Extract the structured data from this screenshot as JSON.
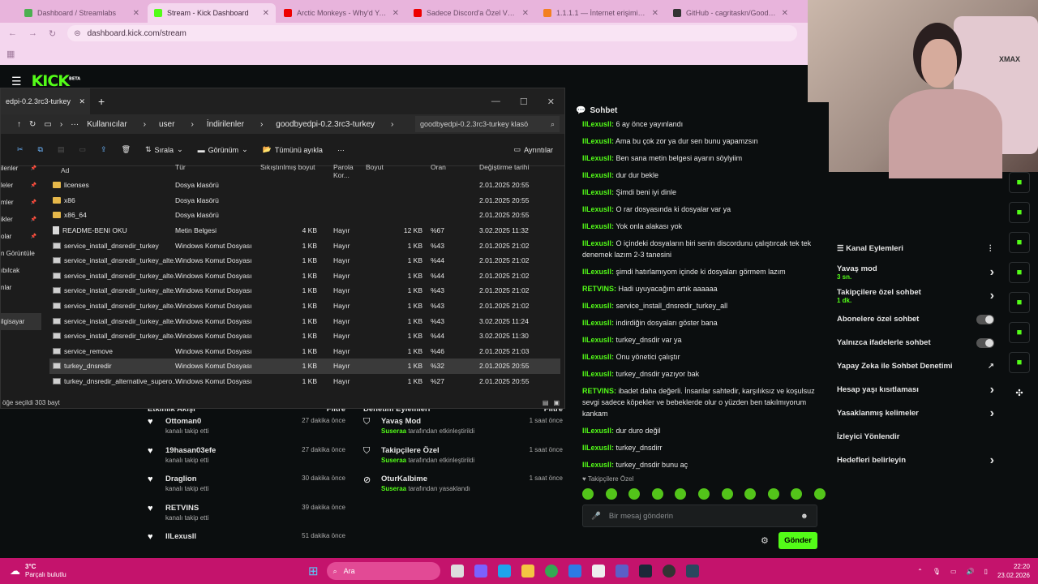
{
  "tabs": [
    {
      "title": "Dashboard / Streamlabs",
      "fav": "#4caf50"
    },
    {
      "title": "Stream - Kick Dashboard",
      "fav": "#53fc18",
      "active": true
    },
    {
      "title": "Arctic Monkeys - Why'd You O",
      "fav": "#e00"
    },
    {
      "title": "Sadece Discord'a Özel VPN N...",
      "fav": "#e00"
    },
    {
      "title": "1.1.1.1 — İnternet erişiminiz n",
      "fav": "#f38020"
    },
    {
      "title": "GitHub - cagritaskn/Goodbyel",
      "fav": "#333"
    }
  ],
  "url": "dashboard.kick.com/stream",
  "kick": {
    "logo": "KICK",
    "beta": "BETA"
  },
  "explorer": {
    "tab_title": "edpi-0.2.3rc3-turkey",
    "crumbs": [
      "Kullanıcılar",
      "user",
      "İndirilenler",
      "goodbyedpi-0.2.3rc3-turkey"
    ],
    "search": "goodbyedpi-0.2.3rc3-turkey klasö",
    "tool": {
      "sort": "Sırala",
      "view": "Görünüm",
      "select_all": "Tümünü ayıkla",
      "details": "Ayrıntılar"
    },
    "sidebar": [
      "ilenler",
      "leler",
      "mler",
      "ikler",
      "olar",
      "n Görüntüle",
      "ıbılcak",
      "nlar",
      "",
      "ilgisayar"
    ],
    "columns": [
      "Ad",
      "Tür",
      "Sıkıştırılmış boyut",
      "Parola Kor...",
      "Boyut",
      "Oran",
      "Değiştirme tarihi"
    ],
    "rows": [
      {
        "name": "licenses",
        "type": "Dosya klasörü",
        "comp": "",
        "pw": "",
        "size": "",
        "ratio": "",
        "date": "2.01.2025 20:55",
        "icon": "folder"
      },
      {
        "name": "x86",
        "type": "Dosya klasörü",
        "comp": "",
        "pw": "",
        "size": "",
        "ratio": "",
        "date": "2.01.2025 20:55",
        "icon": "folder"
      },
      {
        "name": "x86_64",
        "type": "Dosya klasörü",
        "comp": "",
        "pw": "",
        "size": "",
        "ratio": "",
        "date": "2.01.2025 20:55",
        "icon": "folder"
      },
      {
        "name": "README-BENI OKU",
        "type": "Metin Belgesi",
        "comp": "4 KB",
        "pw": "Hayır",
        "size": "12 KB",
        "ratio": "%67",
        "date": "3.02.2025 11:32",
        "icon": "file"
      },
      {
        "name": "service_install_dnsredir_turkey",
        "type": "Windows Komut Dosyası",
        "comp": "1 KB",
        "pw": "Hayır",
        "size": "1 KB",
        "ratio": "%43",
        "date": "2.01.2025 21:02",
        "icon": "cmd"
      },
      {
        "name": "service_install_dnsredir_turkey_alte...",
        "type": "Windows Komut Dosyası",
        "comp": "1 KB",
        "pw": "Hayır",
        "size": "1 KB",
        "ratio": "%44",
        "date": "2.01.2025 21:02",
        "icon": "cmd"
      },
      {
        "name": "service_install_dnsredir_turkey_alte...",
        "type": "Windows Komut Dosyası",
        "comp": "1 KB",
        "pw": "Hayır",
        "size": "1 KB",
        "ratio": "%44",
        "date": "2.01.2025 21:02",
        "icon": "cmd"
      },
      {
        "name": "service_install_dnsredir_turkey_alte...",
        "type": "Windows Komut Dosyası",
        "comp": "1 KB",
        "pw": "Hayır",
        "size": "1 KB",
        "ratio": "%43",
        "date": "2.01.2025 21:02",
        "icon": "cmd"
      },
      {
        "name": "service_install_dnsredir_turkey_alte...",
        "type": "Windows Komut Dosyası",
        "comp": "1 KB",
        "pw": "Hayır",
        "size": "1 KB",
        "ratio": "%43",
        "date": "2.01.2025 21:02",
        "icon": "cmd"
      },
      {
        "name": "service_install_dnsredir_turkey_alte...",
        "type": "Windows Komut Dosyası",
        "comp": "1 KB",
        "pw": "Hayır",
        "size": "1 KB",
        "ratio": "%43",
        "date": "3.02.2025 11:24",
        "icon": "cmd"
      },
      {
        "name": "service_install_dnsredir_turkey_alte...",
        "type": "Windows Komut Dosyası",
        "comp": "1 KB",
        "pw": "Hayır",
        "size": "1 KB",
        "ratio": "%44",
        "date": "3.02.2025 11:30",
        "icon": "cmd"
      },
      {
        "name": "service_remove",
        "type": "Windows Komut Dosyası",
        "comp": "1 KB",
        "pw": "Hayır",
        "size": "1 KB",
        "ratio": "%46",
        "date": "2.01.2025 21:03",
        "icon": "cmd"
      },
      {
        "name": "turkey_dnsredir",
        "type": "Windows Komut Dosyası",
        "comp": "1 KB",
        "pw": "Hayır",
        "size": "1 KB",
        "ratio": "%32",
        "date": "2.01.2025 20:55",
        "icon": "cmd",
        "selected": true
      },
      {
        "name": "turkey_dnsredir_alternative_supero...",
        "type": "Windows Komut Dosyası",
        "comp": "1 KB",
        "pw": "Hayır",
        "size": "1 KB",
        "ratio": "%27",
        "date": "2.01.2025 20:55",
        "icon": "cmd"
      }
    ],
    "status": "öğe seçildi  303 bayt"
  },
  "chat": {
    "title": "Sohbet",
    "messages": [
      {
        "user": "IlLexusll:",
        "text": "6 ay önce yayınlandı"
      },
      {
        "user": "IlLexusll:",
        "text": "Ama bu çok zor ya dur sen bunu yapamzsın"
      },
      {
        "user": "IlLexusll:",
        "text": "Ben sana metin belgesi ayarın söylyiim"
      },
      {
        "user": "IlLexusll:",
        "text": "dur dur bekle"
      },
      {
        "user": "IlLexusll:",
        "text": "Şimdi beni iyi dinle"
      },
      {
        "user": "IlLexusll:",
        "text": "O rar dosyasında ki dosyalar var ya"
      },
      {
        "user": "IlLexusll:",
        "text": "Yok onla alakası yok"
      },
      {
        "user": "IlLexusll:",
        "text": "O içindeki dosyaların biri senin discordunu çalıştırcak tek tek denemek lazım 2-3 tanesini"
      },
      {
        "user": "IlLexusll:",
        "text": "şimdi hatırlamıyom içinde ki dosyaları görmem lazım"
      },
      {
        "user": "RETVINS:",
        "text": "Hadi uyuyacağım artık aaaaaa"
      },
      {
        "user": "IlLexusll:",
        "text": "service_install_dnsredir_turkey_all"
      },
      {
        "user": "IlLexusll:",
        "text": "indirdiğin dosyaları göster bana"
      },
      {
        "user": "IlLexusll:",
        "text": "turkey_dnsdir var ya"
      },
      {
        "user": "IlLexusll:",
        "text": "Onu yönetici çalıştır"
      },
      {
        "user": "IlLexusll:",
        "text": "turkey_dnsdir yazıyor bak"
      },
      {
        "user": "RETVINS:",
        "text": "ibadet daha değerli. İnsanlar sahtedir, karşılıksız ve koşulsuz sevgi sadece köpekler ve bebeklerde olur o yüzden ben takılmıyorum kankam"
      },
      {
        "user": "IlLexusll:",
        "text": "dur duro değil"
      },
      {
        "user": "IlLexusll:",
        "text": "turkey_dnsdirr"
      },
      {
        "user": "IlLexusll:",
        "text": "turkey_dnsdir bunu aç"
      }
    ],
    "followers_only": "Takipçilere Özel",
    "placeholder": "Bir mesaj gönderin",
    "send": "Gönder"
  },
  "channel_actions": {
    "title": "Kanal Eylemleri",
    "items": [
      {
        "label": "Yavaş mod",
        "sub": "3 sn.",
        "ctrl": "chevron"
      },
      {
        "label": "Takipçilere özel sohbet",
        "sub": "1 dk.",
        "ctrl": "chevron"
      },
      {
        "label": "Abonelere özel sohbet",
        "sub": "",
        "ctrl": "toggle"
      },
      {
        "label": "Yalnızca ifadelerle sohbet",
        "sub": "",
        "ctrl": "toggle"
      },
      {
        "label": "Yapay Zeka ile Sohbet Denetimi",
        "sub": "",
        "ctrl": "external"
      },
      {
        "label": "Hesap yaşı kısıtlaması",
        "sub": "",
        "ctrl": "chevron"
      },
      {
        "label": "Yasaklanmış kelimeler",
        "sub": "",
        "ctrl": "chevron"
      },
      {
        "label": "İzleyici Yönlendir",
        "sub": "",
        "ctrl": "none"
      },
      {
        "label": "Hedefleri belirleyin",
        "sub": "",
        "ctrl": "chevron"
      }
    ]
  },
  "camera": {
    "chair_text": "XMAX"
  },
  "activity": {
    "title": "Etkinlik Akışı",
    "filter": "Filtre",
    "events": [
      {
        "name": "Ottoman0",
        "desc": "kanalı takip etti",
        "time": "27 dakika önce"
      },
      {
        "name": "19hasan03efe",
        "desc": "kanalı takip etti",
        "time": "27 dakika önce"
      },
      {
        "name": "Draglion",
        "desc": "kanalı takip etti",
        "time": "30 dakika önce"
      },
      {
        "name": "RETVINS",
        "desc": "kanalı takip etti",
        "time": "39 dakika önce"
      },
      {
        "name": "IlLexusll",
        "desc": "",
        "time": "51 dakika önce"
      }
    ]
  },
  "moderation": {
    "title": "Denetim Eylemleri",
    "filter": "Filtre",
    "events": [
      {
        "name": "Yavaş Mod",
        "by": "Suseraa",
        "desc": "tarafından etkinleştirildi",
        "time": "1 saat önce"
      },
      {
        "name": "Takipçilere Özel",
        "by": "Suseraa",
        "desc": "tarafından etkinleştirildi",
        "time": "1 saat önce"
      },
      {
        "name": "OturKalbime",
        "by": "Suseraa",
        "desc": "tarafından yasaklandı",
        "time": "1 saat önce"
      }
    ]
  },
  "taskbar": {
    "temp": "3°C",
    "weather": "Parçalı bulutlu",
    "search": "Ara",
    "time": "22:20",
    "date": "23.02.2026"
  }
}
